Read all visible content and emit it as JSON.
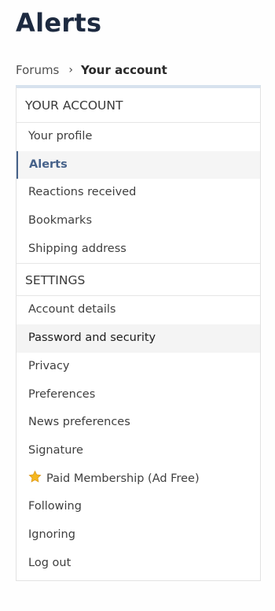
{
  "page": {
    "title": "Alerts"
  },
  "breadcrumb": {
    "root": "Forums",
    "separator": "›",
    "current": "Your account"
  },
  "account_section": {
    "header": "YOUR ACCOUNT",
    "items": [
      {
        "label": "Your profile"
      },
      {
        "label": "Alerts"
      },
      {
        "label": "Reactions received"
      },
      {
        "label": "Bookmarks"
      },
      {
        "label": "Shipping address"
      }
    ]
  },
  "settings_section": {
    "header": "SETTINGS",
    "items": [
      {
        "label": "Account details"
      },
      {
        "label": "Password and security"
      },
      {
        "label": "Privacy"
      },
      {
        "label": "Preferences"
      },
      {
        "label": "News preferences"
      },
      {
        "label": "Signature"
      },
      {
        "label": "Paid Membership (Ad Free)",
        "icon": "star-icon"
      },
      {
        "label": "Following"
      },
      {
        "label": "Ignoring"
      },
      {
        "label": "Log out"
      }
    ]
  },
  "colors": {
    "title": "#1d2a40",
    "active": "#46628a",
    "panel_top_border": "#d7e2ee",
    "star": "#f5b71f"
  }
}
